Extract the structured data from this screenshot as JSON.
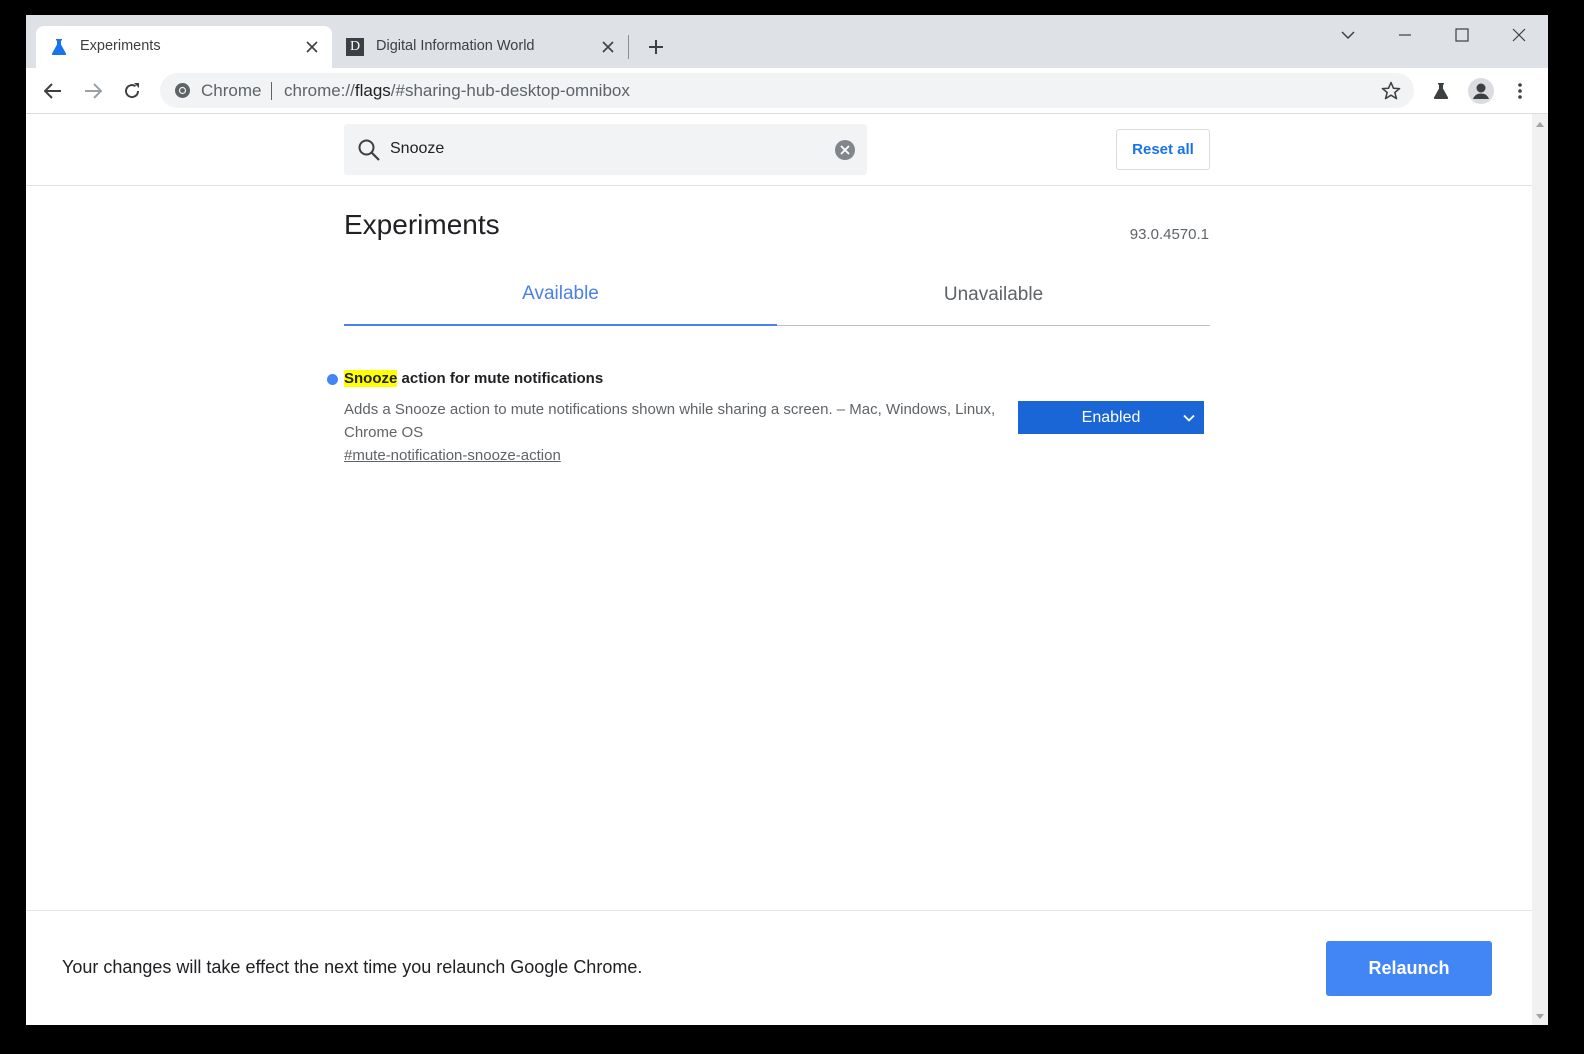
{
  "browser": {
    "tabs": [
      {
        "title": "Experiments",
        "favicon": "flask-icon",
        "active": true
      },
      {
        "title": "Digital Information World",
        "favicon": "D",
        "active": false
      }
    ],
    "omnibox": {
      "chip": "Chrome",
      "url_prefix": "chrome://",
      "url_strong": "flags",
      "url_suffix": "/#sharing-hub-desktop-omnibox"
    }
  },
  "search": {
    "value": "Snooze",
    "reset_label": "Reset all"
  },
  "page": {
    "title": "Experiments",
    "version": "93.0.4570.1",
    "tabs": [
      {
        "label": "Available",
        "selected": true
      },
      {
        "label": "Unavailable",
        "selected": false
      }
    ]
  },
  "experiments": [
    {
      "name_highlight": "Snooze",
      "name_rest": " action for mute notifications",
      "description": "Adds a Snooze action to mute notifications shown while sharing a screen. – Mac, Windows, Linux, Chrome OS",
      "link": "#mute-notification-snooze-action",
      "state": "Enabled"
    }
  ],
  "footer": {
    "message": "Your changes will take effect the next time you relaunch Google Chrome.",
    "relaunch_label": "Relaunch"
  },
  "colors": {
    "accent": "#1a73e8",
    "select_bg": "#1a66d6",
    "relaunch_bg": "#4285f4",
    "highlight": "#ffff00",
    "tabstrip": "#dee1e6"
  }
}
